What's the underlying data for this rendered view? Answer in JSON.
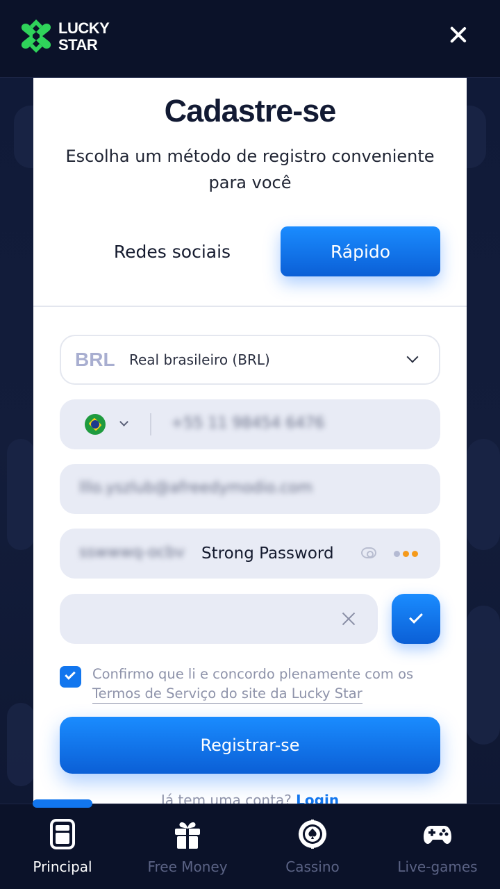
{
  "header": {
    "logo_line1": "LUCKY",
    "logo_line2": "STAR"
  },
  "modal": {
    "title": "Cadastre-se",
    "subtitle": "Escolha um método de registro conveniente para você",
    "tabs": [
      {
        "label": "Redes sociais",
        "active": false
      },
      {
        "label": "Rápido",
        "active": true
      }
    ],
    "currency": {
      "code": "BRL",
      "name": "Real brasileiro (BRL)"
    },
    "phone": {
      "value": "+55 11 98454 6476"
    },
    "email": {
      "value": "lllo.yszlub@afreedymodio.com"
    },
    "password": {
      "value": "sswwwq-ocbv",
      "strength_label": "Strong Password"
    },
    "promo": {
      "value": ""
    },
    "agree": {
      "text": "Confirmo que li e concordo plenamente com os",
      "link": "Termos de Serviço do site da Lucky Star",
      "checked": true
    },
    "register_label": "Registrar-se",
    "login_prompt": "Já tem uma conta?",
    "login_link": "Login"
  },
  "bottom_nav": {
    "items": [
      {
        "label": "Principal",
        "icon": "home-screen-icon",
        "active": true
      },
      {
        "label": "Free Money",
        "icon": "gift-icon",
        "active": false
      },
      {
        "label": "Cassino",
        "icon": "casino-chip-icon",
        "active": false
      },
      {
        "label": "Live-games",
        "icon": "gamepad-icon",
        "active": false
      }
    ]
  },
  "colors": {
    "accent": "#1276ee",
    "logo_green": "#2fd35a",
    "strength_dots": [
      "#b4bad3",
      "#f59a1b",
      "#f59a1b"
    ]
  }
}
